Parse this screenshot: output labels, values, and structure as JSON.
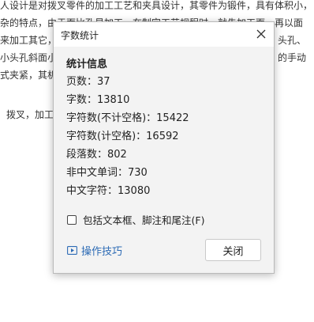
{
  "document": {
    "lines": [
      "人设计是对拨叉零件的加工工艺和夹具设计，其零件为锻件，具有体积小，",
      "杂的特点，由于面比孔易加工，在制定工艺规程时，就先加工面，再以面",
      "来加工其它，",
      "小头孔斜面小",
      "式夹紧，其机",
      "拨叉，加工"
    ],
    "right_fragments": [
      "头孔、",
      "的手动"
    ]
  },
  "dialog": {
    "title": "字数统计",
    "stats_heading": "统计信息",
    "stats": [
      {
        "label": "页数：",
        "value": "37"
      },
      {
        "label": "字数：",
        "value": "13810"
      },
      {
        "label": "字符数(不计空格)：",
        "value": "15422"
      },
      {
        "label": "字符数(计空格)：",
        "value": "16592"
      },
      {
        "label": "段落数：",
        "value": "802"
      },
      {
        "label": "非中文单词：",
        "value": "730"
      },
      {
        "label": "中文字符：",
        "value": "13080"
      }
    ],
    "checkbox": {
      "label": "包括文本框、脚注和尾注(F)",
      "checked": false
    },
    "tips_link": "操作技巧",
    "close_label": "关闭",
    "icons": {
      "close": "close-icon",
      "tips": "video-tips-icon"
    },
    "colors": {
      "link": "#2d6bb5",
      "background": "#f3f3f3"
    }
  }
}
